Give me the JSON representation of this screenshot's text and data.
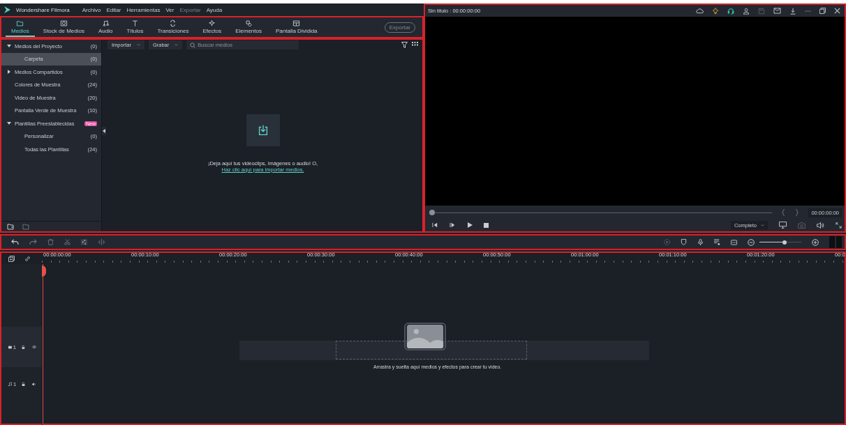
{
  "app": {
    "name": "Wondershare Filmora"
  },
  "menu": [
    {
      "label": "Archivo",
      "disabled": false
    },
    {
      "label": "Editar",
      "disabled": false
    },
    {
      "label": "Herramientas",
      "disabled": false
    },
    {
      "label": "Ver",
      "disabled": false
    },
    {
      "label": "Exportar",
      "disabled": true
    },
    {
      "label": "Ayuda",
      "disabled": false
    }
  ],
  "tabs": [
    {
      "label": "Medios",
      "selected": true
    },
    {
      "label": "Stock de Medios",
      "selected": false
    },
    {
      "label": "Audio",
      "selected": false
    },
    {
      "label": "Títulos",
      "selected": false
    },
    {
      "label": "Transiciones",
      "selected": false
    },
    {
      "label": "Efectos",
      "selected": false
    },
    {
      "label": "Elementos",
      "selected": false
    },
    {
      "label": "Pantalla Dividida",
      "selected": false
    }
  ],
  "export_button": {
    "label": "Exportar",
    "disabled": true
  },
  "library": [
    {
      "label": "Medios del Proyecto",
      "count": "(0)",
      "expanded": true,
      "selected": false,
      "children": [
        {
          "label": "Carpeta",
          "count": "(0)",
          "selected": true
        }
      ]
    },
    {
      "label": "Medios Compartidos",
      "count": "(0)",
      "expanded": false,
      "selected": false
    },
    {
      "label": "Colores de Muestra",
      "count": "(24)",
      "selected": false
    },
    {
      "label": "Video de Muestra",
      "count": "(20)",
      "selected": false
    },
    {
      "label": "Pantalla Verde de Muestra",
      "count": "(10)",
      "selected": false
    },
    {
      "label": "Plantillas Preestablecidas",
      "badge": "New",
      "expanded": true,
      "selected": false,
      "children": [
        {
          "label": "Personalizar",
          "count": "(0)",
          "selected": false
        },
        {
          "label": "Todas las Plantillas",
          "count": "(24)",
          "selected": false
        }
      ]
    }
  ],
  "media_toolbar": {
    "import": "Importar",
    "record": "Grabar",
    "search_placeholder": "Buscar medios"
  },
  "drop_zone": {
    "message": "¡Deja aquí tus videoclips, imágenes o audio! O,",
    "link": "Haz clic aquí para importar medios."
  },
  "preview": {
    "title": "Sin título : 00:00:00:00",
    "level": 0,
    "timecode": "00:00:00:00",
    "quality": "Completo"
  },
  "timeline": {
    "zoom": {
      "level": 0.6
    },
    "ruler": [
      "00:00:00:00",
      "00:00:10:00",
      "00:00:20:00",
      "00:00:30:00",
      "00:00:40:00",
      "00:00:50:00",
      "00:01:00:00",
      "00:01:10:00",
      "00:01:20:00",
      "00:0"
    ],
    "tracks": [
      {
        "kind": "video",
        "number": "1"
      },
      {
        "kind": "audio",
        "number": "1"
      }
    ],
    "hint": "Arrastra y suelta aquí medios y efectos para crear tu video."
  }
}
